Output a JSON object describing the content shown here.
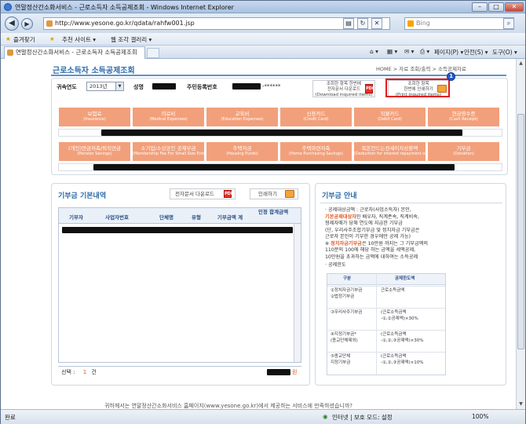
{
  "window": {
    "title": "연말정산간소화서비스 - 근로소득자 소득공제조회 - Windows Internet Explorer",
    "min": "–",
    "max": "□",
    "close": "✕"
  },
  "browser": {
    "url": "http://www.yesone.go.kr/qdata/rahfw001.jsp",
    "search_placeholder": "Bing",
    "favorites_label": "즐겨찾기",
    "suggested_sites": "추천 사이트 ▾",
    "web_slice": "웹 조각 갤러리 ▾",
    "tab_title": "연말정산간소화서비스 - 근로소득자 소득공제조회",
    "cmd_page": "페이지(P) ▾",
    "cmd_safety": "안전(S) ▾",
    "cmd_tools": "도구(O) ▾",
    "cmd_help": "❷ ▾"
  },
  "page": {
    "title": "근로소득자 소득공제조회",
    "breadcrumb": "HOME > 자료 조회/출력 > 소득공제자료",
    "year_label": "귀속연도",
    "year_value": "2013년",
    "name_label": "성명",
    "rrn_label": "주민등록번호",
    "rrn_masked": "-******",
    "dl_btn": [
      "조회한 항목 한번에",
      "전자문서 다운로드",
      "(Download inquired items)"
    ],
    "print_btn": [
      "조회한 항목",
      "한번에 인쇄하기",
      "(Print inquired items)"
    ],
    "badge": "1",
    "cats_row1": [
      {
        "ko": "보험료",
        "en": "(Insurance)"
      },
      {
        "ko": "의료비",
        "en": "(Medical Expenses)"
      },
      {
        "ko": "교육비",
        "en": "(Education Expenses)"
      },
      {
        "ko": "신용카드",
        "en": "(Credit Card)"
      },
      {
        "ko": "직불카드",
        "en": "(Debit Card)"
      },
      {
        "ko": "현금영수증",
        "en": "(Cash Receipt)"
      }
    ],
    "cats_row2": [
      {
        "ko": "(개인)연금저축/퇴직연금",
        "en": "(Pension Savings)"
      },
      {
        "ko": "소기업/소상공인 공제부금",
        "en": "(Membership Fee For Small Size Enterprises)"
      },
      {
        "ko": "주택자금",
        "en": "(Housing Funds)"
      },
      {
        "ko": "주택마련저축",
        "en": "(Home Purchasing Savings)"
      },
      {
        "ko": "목돈안드는전세이자상환액",
        "en": "(Deduction for interest repayment on deposit-based lease)"
      },
      {
        "ko": "기부금",
        "en": "(Donation)"
      }
    ]
  },
  "donation": {
    "title": "기부금 기본내역",
    "dl_label": "전자문서 다운로드",
    "print_label": "인쇄하기",
    "columns": [
      "기부자",
      "사업자번호",
      "단체명",
      "유형",
      "기부금액 계",
      "인정 합계금액"
    ],
    "selected_label": "선택 :",
    "selected_count": "1",
    "selected_unit": "건",
    "won": "원"
  },
  "guide": {
    "title": "기부금 안내",
    "b1_a": "공제대상금액 : 근로자(사업소득자) 본인,",
    "b1_b": "기본공제대상자",
    "b1_c": "인 배우자, 직계존속, 직계비속,",
    "b1_d": "형제자매가 당해 연도에 지급한 기부금",
    "b1_e": "(단, 우리사주조합기부금 및 정치자금 기부금은",
    "b1_f": "근로자 본인이 기부한 경우에만 공제 가능)",
    "b2_a": "※ ",
    "b2_b": "정치자금기부금",
    "b2_c": "은 10만원 까지는 그 기부금액의",
    "b2_d": "110분의 100에 해당 하는 금액을 세액공제,",
    "b2_e": "10만원을 초과하는 금액에 대하여는 소득공제",
    "b3": "공제한도",
    "tbl_head": [
      "구분",
      "공제한도액"
    ],
    "rows": [
      {
        "a": "①정치자금기부금",
        "a2": "②법정기부금",
        "b": "근로소득금액",
        "b2": ""
      },
      {
        "a": "③우리사주기부금",
        "a2": "",
        "b": "(근로소득금액",
        "b2": "-①,②공제액)×30%"
      },
      {
        "a": "④지정기부금*",
        "a2": "(종교단체제외)",
        "b": "(근로소득금액",
        "b2": "-①,②,③공제액)×30%"
      },
      {
        "a": "⑤종교단체",
        "a2": "지정기부금",
        "b": "(근로소득금액",
        "b2": "-①,②,③공제액)×10%"
      }
    ]
  },
  "survey": "귀하께서는 연말정산간소화서비스 홈페이지(www.yesone.go.kr)에서 제공하는 서비스에 만족하셨습니까?",
  "survey_bold": "연말정산간소화서비스 홈페이지",
  "status": {
    "left": "완료",
    "zone": "인터넷 | 보호 모드: 설정",
    "zoom": "100%"
  }
}
